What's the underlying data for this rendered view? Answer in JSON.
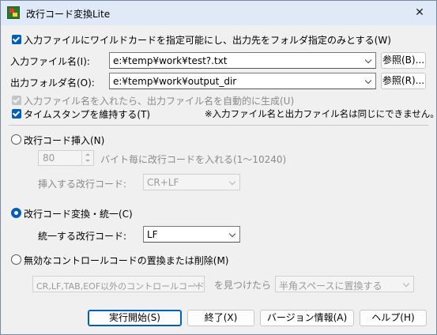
{
  "window": {
    "title": "改行コード変換Lite",
    "icon": "app-icon",
    "close_glyph": "✕"
  },
  "options": {
    "wildcard_checkbox": {
      "label": "入力ファイルにワイルドカードを指定可能にし、出力先をフォルダ指定のみとする(W)",
      "checked": true
    }
  },
  "input_file": {
    "label": "入力ファイル名(I):",
    "value": "e:¥temp¥work¥test?.txt",
    "browse": "参照(B)..."
  },
  "output_folder": {
    "label": "出力フォルダ名(O):",
    "value": "e:¥temp¥work¥output_dir",
    "browse": "参照(R)..."
  },
  "auto_name": {
    "label": "入力ファイル名を入れたら、出力ファイル名を自動的に生成(U)",
    "checked": true,
    "disabled": true
  },
  "timestamp": {
    "label": "タイムスタンプを維持する(T)",
    "checked": true
  },
  "note": "※入力ファイル名と出力ファイル名は同じにできません。",
  "insert": {
    "radio_label": "改行コード挿入(N)",
    "selected": false,
    "count_value": "80",
    "count_suffix": "バイト毎に改行コードを入れる(1〜10240)",
    "code_label": "挿入する改行コード:",
    "code_value": "CR+LF"
  },
  "convert": {
    "radio_label": "改行コード変換・統一(C)",
    "selected": true,
    "code_label": "統一する改行コード:",
    "code_value": "LF"
  },
  "invalid": {
    "radio_label": "無効なコントロールコードの置換または削除(M)",
    "selected": false,
    "target_value": "CR,LF,TAB,EOF以外のコントロールコード",
    "middle_text": "を見つけたら",
    "action_value": "半角スペースに置換する"
  },
  "buttons": {
    "run": "実行開始(S)",
    "exit": "終了(X)",
    "version": "バージョン情報(A)",
    "help": "ヘルプ(H)"
  },
  "colors": {
    "accent": "#005fb8",
    "titlebar": "#dfe9f7",
    "dialog_bg": "#f0f0f0"
  }
}
